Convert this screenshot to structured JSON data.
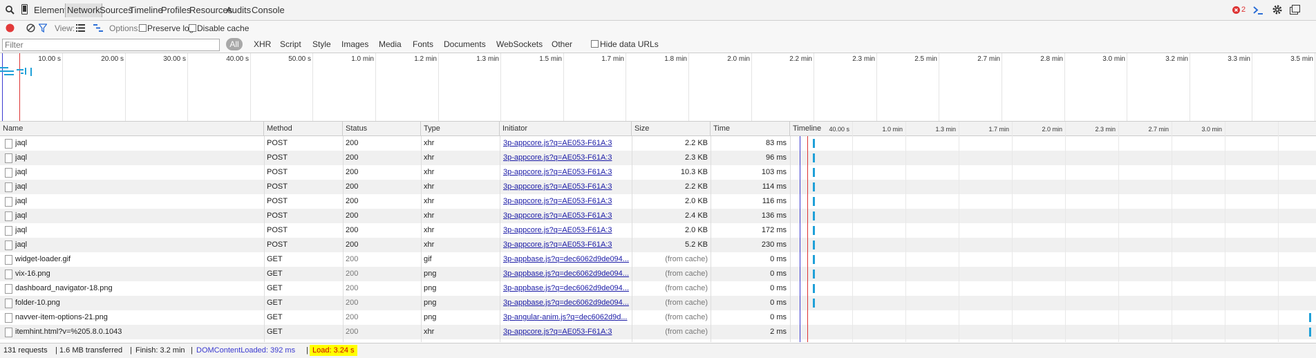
{
  "tabs": [
    {
      "label": "Elements"
    },
    {
      "label": "Network"
    },
    {
      "label": "Sources"
    },
    {
      "label": "Timeline"
    },
    {
      "label": "Profiles"
    },
    {
      "label": "Resources"
    },
    {
      "label": "Audits"
    },
    {
      "label": "Console"
    }
  ],
  "error_count": "2",
  "toolbar": {
    "view_label": "View:",
    "options_label": "Options:",
    "preserve_log": "Preserve log",
    "disable_cache": "Disable cache"
  },
  "filterbar": {
    "placeholder": "Filter",
    "all": "All",
    "types": [
      "XHR",
      "Script",
      "Style",
      "Images",
      "Media",
      "Fonts",
      "Documents",
      "WebSockets",
      "Other"
    ],
    "hide_data_urls": "Hide data URLs"
  },
  "overview_ticks": [
    "10.00 s",
    "20.00 s",
    "30.00 s",
    "40.00 s",
    "50.00 s",
    "1.0 min",
    "1.2 min",
    "1.3 min",
    "1.5 min",
    "1.7 min",
    "1.8 min",
    "2.0 min",
    "2.2 min",
    "2.3 min",
    "2.5 min",
    "2.7 min",
    "2.8 min",
    "3.0 min",
    "3.2 min",
    "3.3 min",
    "3.5 min"
  ],
  "columns": {
    "name": "Name",
    "method": "Method",
    "status": "Status",
    "type": "Type",
    "initiator": "Initiator",
    "size": "Size",
    "time": "Time",
    "timeline": "Timeline"
  },
  "timeline_ticks": [
    "40.00 s",
    "1.0 min",
    "1.3 min",
    "1.7 min",
    "2.0 min",
    "2.3 min",
    "2.7 min",
    "3.0 min"
  ],
  "rows": [
    {
      "name": "jaql",
      "method": "POST",
      "status": "200",
      "type": "xhr",
      "initiator": "3p-appcore.js?q=AE053-F61A:3",
      "size": "2.2 KB",
      "time": "83 ms",
      "bar": 0.0
    },
    {
      "name": "jaql",
      "method": "POST",
      "status": "200",
      "type": "xhr",
      "initiator": "3p-appcore.js?q=AE053-F61A:3",
      "size": "2.3 KB",
      "time": "96 ms",
      "bar": 0.0
    },
    {
      "name": "jaql",
      "method": "POST",
      "status": "200",
      "type": "xhr",
      "initiator": "3p-appcore.js?q=AE053-F61A:3",
      "size": "10.3 KB",
      "time": "103 ms",
      "bar": 0.0
    },
    {
      "name": "jaql",
      "method": "POST",
      "status": "200",
      "type": "xhr",
      "initiator": "3p-appcore.js?q=AE053-F61A:3",
      "size": "2.2 KB",
      "time": "114 ms",
      "bar": 0.0
    },
    {
      "name": "jaql",
      "method": "POST",
      "status": "200",
      "type": "xhr",
      "initiator": "3p-appcore.js?q=AE053-F61A:3",
      "size": "2.0 KB",
      "time": "116 ms",
      "bar": 0.0
    },
    {
      "name": "jaql",
      "method": "POST",
      "status": "200",
      "type": "xhr",
      "initiator": "3p-appcore.js?q=AE053-F61A:3",
      "size": "2.4 KB",
      "time": "136 ms",
      "bar": 0.0
    },
    {
      "name": "jaql",
      "method": "POST",
      "status": "200",
      "type": "xhr",
      "initiator": "3p-appcore.js?q=AE053-F61A:3",
      "size": "2.0 KB",
      "time": "172 ms",
      "bar": 0.0
    },
    {
      "name": "jaql",
      "method": "POST",
      "status": "200",
      "type": "xhr",
      "initiator": "3p-appcore.js?q=AE053-F61A:3",
      "size": "5.2 KB",
      "time": "230 ms",
      "bar": 0.0
    },
    {
      "name": "widget-loader.gif",
      "method": "GET",
      "status": "200",
      "type": "gif",
      "initiator": "3p-appbase.js?q=dec6062d9de094...",
      "size": "(from cache)",
      "time": "0 ms",
      "bar": 0.0
    },
    {
      "name": "vix-16.png",
      "method": "GET",
      "status": "200",
      "type": "png",
      "initiator": "3p-appbase.js?q=dec6062d9de094...",
      "size": "(from cache)",
      "time": "0 ms",
      "bar": 0.0
    },
    {
      "name": "dashboard_navigator-18.png",
      "method": "GET",
      "status": "200",
      "type": "png",
      "initiator": "3p-appbase.js?q=dec6062d9de094...",
      "size": "(from cache)",
      "time": "0 ms",
      "bar": 0.0
    },
    {
      "name": "folder-10.png",
      "method": "GET",
      "status": "200",
      "type": "png",
      "initiator": "3p-appbase.js?q=dec6062d9de094...",
      "size": "(from cache)",
      "time": "0 ms",
      "bar": 0.0
    },
    {
      "name": "navver-item-options-21.png",
      "method": "GET",
      "status": "200",
      "type": "png",
      "initiator": "3p-angular-anim.js?q=dec6062d9d...",
      "size": "(from cache)",
      "time": "0 ms",
      "bar": 1.0
    },
    {
      "name": "itemhint.html?v=%205.8.0.1043",
      "method": "GET",
      "status": "200",
      "type": "xhr",
      "initiator": "3p-appcore.js?q=AE053-F61A:3",
      "size": "(from cache)",
      "time": "2 ms",
      "bar": 1.0
    }
  ],
  "status": {
    "requests": "131 requests",
    "transferred": "1.6 MB transferred",
    "finish": "Finish: 3.2 min",
    "dom": "DOMContentLoaded: 392 ms",
    "load": "Load: 3.24 s"
  },
  "colors": {
    "dom": "#3a3ad0",
    "load": "#cc0000",
    "load_bg": "#ffff00",
    "bar": "#1fa0d8"
  }
}
